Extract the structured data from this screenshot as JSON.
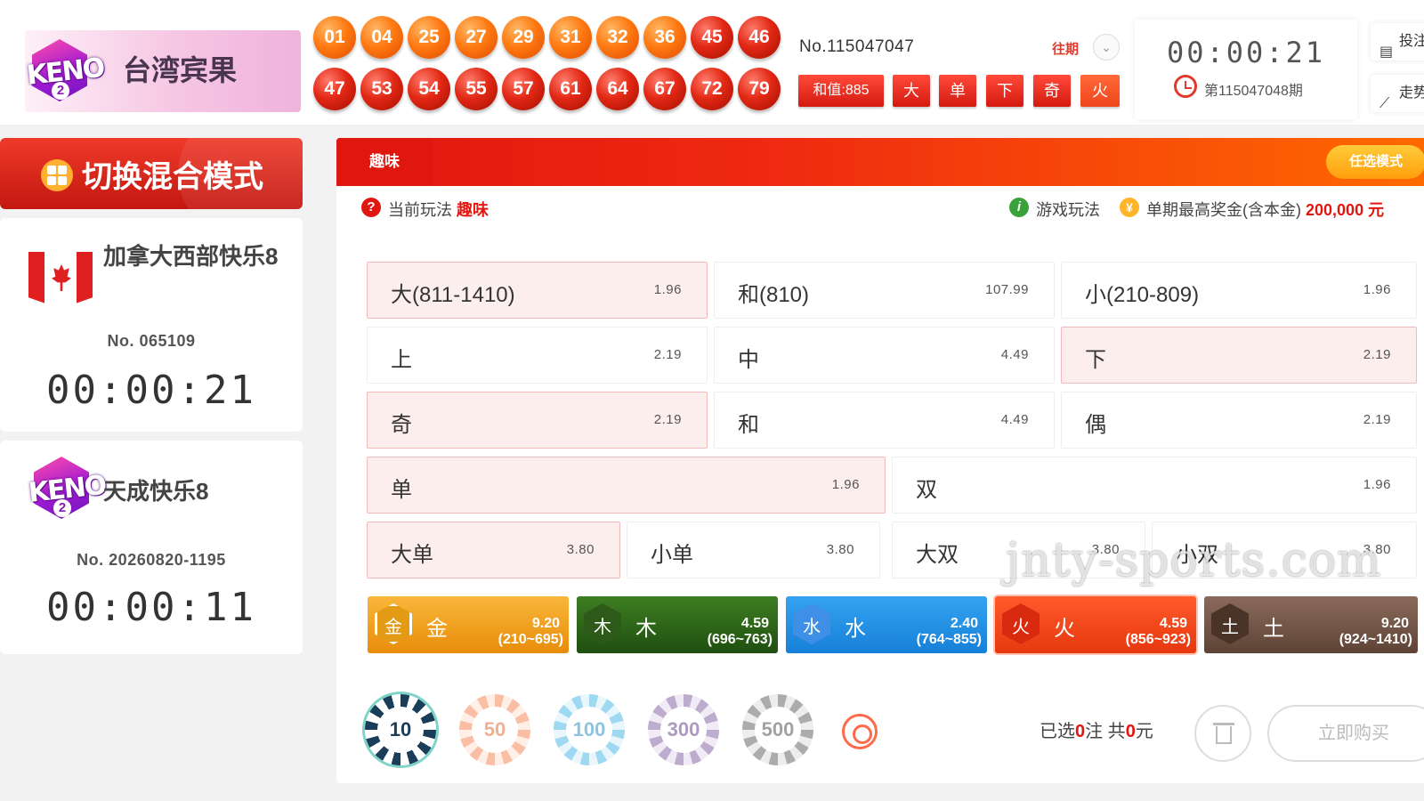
{
  "header": {
    "lottery_name": "台湾宾果",
    "issue_no": "No.115047047",
    "history_label": "往期",
    "balls_row1": [
      "01",
      "04",
      "25",
      "27",
      "29",
      "31",
      "32",
      "36",
      "45",
      "46"
    ],
    "balls_row2": [
      "47",
      "53",
      "54",
      "55",
      "57",
      "61",
      "64",
      "67",
      "72",
      "79"
    ],
    "sum_label": "和值:885",
    "tags": [
      "大",
      "单",
      "下",
      "奇",
      "火"
    ],
    "countdown": "00:00:21",
    "next_issue": "第115047048期",
    "side_buttons": [
      "投注",
      "走势"
    ]
  },
  "sidebar": {
    "switch_label": "切换混合模式",
    "games": [
      {
        "name": "加拿大西部快乐8",
        "no": "No. 065109",
        "time": "00:00:21"
      },
      {
        "name": "天成快乐8",
        "no": "No. 20260820-1195",
        "time": "00:00:11"
      }
    ]
  },
  "main": {
    "tab": "趣味",
    "optional_mode": "任选模式",
    "current_play_label": "当前玩法",
    "current_play_value": "趣味",
    "rules_label": "游戏玩法",
    "max_prize_label": "单期最高奖金(含本金)",
    "max_prize_value": "200,000 元",
    "bets": [
      {
        "label": "大(811-1410)",
        "odds": "1.96"
      },
      {
        "label": "和(810)",
        "odds": "107.99"
      },
      {
        "label": "小(210-809)",
        "odds": "1.96"
      },
      {
        "label": "上",
        "odds": "2.19"
      },
      {
        "label": "中",
        "odds": "4.49"
      },
      {
        "label": "下",
        "odds": "2.19"
      },
      {
        "label": "奇",
        "odds": "2.19"
      },
      {
        "label": "和",
        "odds": "4.49"
      },
      {
        "label": "偶",
        "odds": "2.19"
      },
      {
        "label": "单",
        "odds": "1.96"
      },
      {
        "label": "双",
        "odds": "1.96"
      },
      {
        "label": "大单",
        "odds": "3.80"
      },
      {
        "label": "小单",
        "odds": "3.80"
      },
      {
        "label": "大双",
        "odds": "3.80"
      },
      {
        "label": "小双",
        "odds": "3.80"
      }
    ],
    "elements": [
      {
        "icon": "金",
        "name": "金",
        "odds": "9.20",
        "range": "(210~695)",
        "color": "#f7a21b"
      },
      {
        "icon": "木",
        "name": "木",
        "odds": "4.59",
        "range": "(696~763)",
        "color": "#2f6b1a"
      },
      {
        "icon": "水",
        "name": "水",
        "odds": "2.40",
        "range": "(764~855)",
        "color": "#1f8fe6"
      },
      {
        "icon": "火",
        "name": "火",
        "odds": "4.59",
        "range": "(856~923)",
        "color": "#f0461c"
      },
      {
        "icon": "土",
        "name": "土",
        "odds": "9.20",
        "range": "(924~1410)",
        "color": "#7a5a4a"
      }
    ],
    "chips": [
      "10",
      "50",
      "100",
      "300",
      "500"
    ],
    "selected_label_a": "已选",
    "selected_count": "0",
    "selected_label_b": "注 共",
    "selected_amount": "0",
    "selected_label_c": "元",
    "buy_label": "立即购买"
  },
  "watermark": "jnty-sports.com"
}
